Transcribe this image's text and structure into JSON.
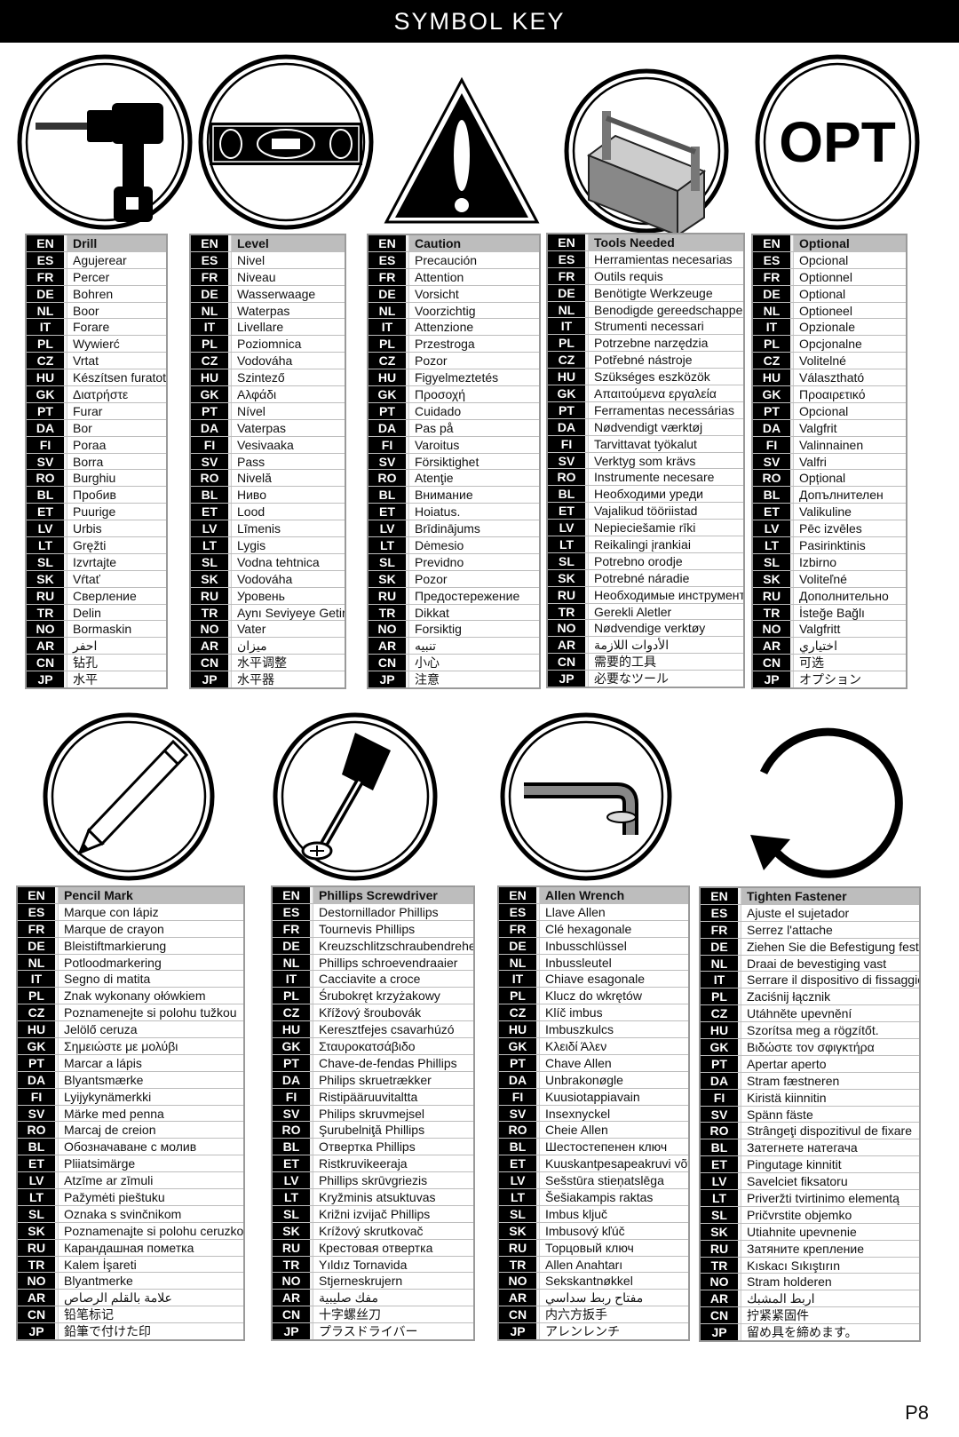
{
  "header": {
    "title": "SYMBOL KEY"
  },
  "page_number": "P8",
  "symbols": [
    {
      "icon": "drill-icon",
      "rows": [
        [
          "EN",
          "Drill"
        ],
        [
          "ES",
          "Agujerear"
        ],
        [
          "FR",
          "Percer"
        ],
        [
          "DE",
          "Bohren"
        ],
        [
          "NL",
          "Boor"
        ],
        [
          "IT",
          "Forare"
        ],
        [
          "PL",
          "Wywierć"
        ],
        [
          "CZ",
          "Vrtat"
        ],
        [
          "HU",
          "Készítsen furatot"
        ],
        [
          "GK",
          "Διατρήστε"
        ],
        [
          "PT",
          "Furar"
        ],
        [
          "DA",
          "Bor"
        ],
        [
          "FI",
          "Poraa"
        ],
        [
          "SV",
          "Borra"
        ],
        [
          "RO",
          "Burghiu"
        ],
        [
          "BL",
          "Пробив"
        ],
        [
          "ET",
          "Puurige"
        ],
        [
          "LV",
          "Urbis"
        ],
        [
          "LT",
          "Gręžti"
        ],
        [
          "SL",
          "Izvrtajte"
        ],
        [
          "SK",
          "Vŕtať"
        ],
        [
          "RU",
          "Сверление"
        ],
        [
          "TR",
          "Delin"
        ],
        [
          "NO",
          "Bormaskin"
        ],
        [
          "AR",
          "احفر"
        ],
        [
          "CN",
          "钻孔"
        ],
        [
          "JP",
          "水平"
        ]
      ]
    },
    {
      "icon": "level-icon",
      "rows": [
        [
          "EN",
          "Level"
        ],
        [
          "ES",
          "Nivel"
        ],
        [
          "FR",
          "Niveau"
        ],
        [
          "DE",
          "Wasserwaage"
        ],
        [
          "NL",
          "Waterpas"
        ],
        [
          "IT",
          "Livellare"
        ],
        [
          "PL",
          "Poziomnica"
        ],
        [
          "CZ",
          "Vodováha"
        ],
        [
          "HU",
          "Szintező"
        ],
        [
          "GK",
          "Αλφάδι"
        ],
        [
          "PT",
          "Nível"
        ],
        [
          "DA",
          "Vaterpas"
        ],
        [
          "FI",
          "Vesivaaka"
        ],
        [
          "SV",
          "Pass"
        ],
        [
          "RO",
          "Nivelă"
        ],
        [
          "BL",
          "Ниво"
        ],
        [
          "ET",
          "Lood"
        ],
        [
          "LV",
          "Līmenis"
        ],
        [
          "LT",
          "Lygis"
        ],
        [
          "SL",
          "Vodna tehtnica"
        ],
        [
          "SK",
          "Vodováha"
        ],
        [
          "RU",
          "Уровень"
        ],
        [
          "TR",
          "Aynı Seviyeye Getir"
        ],
        [
          "NO",
          "Vater"
        ],
        [
          "AR",
          "ميزان"
        ],
        [
          "CN",
          "水平调整"
        ],
        [
          "JP",
          "水平器"
        ]
      ]
    },
    {
      "icon": "caution-icon",
      "rows": [
        [
          "EN",
          "Caution"
        ],
        [
          "ES",
          "Precaución"
        ],
        [
          "FR",
          "Attention"
        ],
        [
          "DE",
          "Vorsicht"
        ],
        [
          "NL",
          "Voorzichtig"
        ],
        [
          "IT",
          "Attenzione"
        ],
        [
          "PL",
          "Przestroga"
        ],
        [
          "CZ",
          "Pozor"
        ],
        [
          "HU",
          "Figyelmeztetés"
        ],
        [
          "GK",
          "Προσοχή"
        ],
        [
          "PT",
          "Cuidado"
        ],
        [
          "DA",
          "Pas på"
        ],
        [
          "FI",
          "Varoitus"
        ],
        [
          "SV",
          "Försiktighet"
        ],
        [
          "RO",
          "Atenţie"
        ],
        [
          "BL",
          "Внимание"
        ],
        [
          "ET",
          "Hoiatus."
        ],
        [
          "LV",
          "Brīdinājums"
        ],
        [
          "LT",
          "Dėmesio"
        ],
        [
          "SL",
          "Previdno"
        ],
        [
          "SK",
          "Pozor"
        ],
        [
          "RU",
          "Предостережение"
        ],
        [
          "TR",
          "Dikkat"
        ],
        [
          "NO",
          "Forsiktig"
        ],
        [
          "AR",
          "تنبيه"
        ],
        [
          "CN",
          "小心"
        ],
        [
          "JP",
          "注意"
        ]
      ]
    },
    {
      "icon": "toolbox-icon",
      "rows": [
        [
          "EN",
          "Tools Needed"
        ],
        [
          "ES",
          "Herramientas necesarias"
        ],
        [
          "FR",
          "Outils requis"
        ],
        [
          "DE",
          "Benötigte Werkzeuge"
        ],
        [
          "NL",
          "Benodigde gereedschappen"
        ],
        [
          "IT",
          "Strumenti necessari"
        ],
        [
          "PL",
          "Potrzebne narzędzia"
        ],
        [
          "CZ",
          "Potřebné nástroje"
        ],
        [
          "HU",
          "Szükséges eszközök"
        ],
        [
          "GK",
          "Απαιτούμενα εργαλεία"
        ],
        [
          "PT",
          "Ferramentas necessárias"
        ],
        [
          "DA",
          "Nødvendigt værktøj"
        ],
        [
          "FI",
          "Tarvittavat työkalut"
        ],
        [
          "SV",
          "Verktyg som krävs"
        ],
        [
          "RO",
          "Instrumente necesare"
        ],
        [
          "BL",
          "Необходими уреди"
        ],
        [
          "ET",
          "Vajalikud tööriistad"
        ],
        [
          "LV",
          "Nepieciešamie rīki"
        ],
        [
          "LT",
          "Reikalingi įrankiai"
        ],
        [
          "SL",
          "Potrebno orodje"
        ],
        [
          "SK",
          "Potrebné náradie"
        ],
        [
          "RU",
          "Необходимые инструменты"
        ],
        [
          "TR",
          "Gerekli Aletler"
        ],
        [
          "NO",
          "Nødvendige verktøy"
        ],
        [
          "AR",
          "الأدوات اللازمة"
        ],
        [
          "CN",
          "需要的工具"
        ],
        [
          "JP",
          "必要なツール"
        ]
      ]
    },
    {
      "icon": "optional-icon",
      "icon_text": "OPT",
      "rows": [
        [
          "EN",
          "Optional"
        ],
        [
          "ES",
          "Opcional"
        ],
        [
          "FR",
          "Optionnel"
        ],
        [
          "DE",
          "Optional"
        ],
        [
          "NL",
          "Optioneel"
        ],
        [
          "IT",
          "Opzionale"
        ],
        [
          "PL",
          "Opcjonalne"
        ],
        [
          "CZ",
          "Volitelné"
        ],
        [
          "HU",
          "Választható"
        ],
        [
          "GK",
          "Προαιρετικό"
        ],
        [
          "PT",
          "Opcional"
        ],
        [
          "DA",
          "Valgfrit"
        ],
        [
          "FI",
          "Valinnainen"
        ],
        [
          "SV",
          "Valfri"
        ],
        [
          "RO",
          "Opțional"
        ],
        [
          "BL",
          "Допълнителен"
        ],
        [
          "ET",
          "Valikuline"
        ],
        [
          "LV",
          "Pēc izvēles"
        ],
        [
          "LT",
          "Pasirinktinis"
        ],
        [
          "SL",
          "Izbirno"
        ],
        [
          "SK",
          "Voliteľné"
        ],
        [
          "RU",
          "Дополнительно"
        ],
        [
          "TR",
          "İsteğe Bağlı"
        ],
        [
          "NO",
          "Valgfritt"
        ],
        [
          "AR",
          "اختياري"
        ],
        [
          "CN",
          "可选"
        ],
        [
          "JP",
          "オプション"
        ]
      ]
    },
    {
      "icon": "pencil-icon",
      "rows": [
        [
          "EN",
          "Pencil Mark"
        ],
        [
          "ES",
          "Marque con lápiz"
        ],
        [
          "FR",
          "Marque de crayon"
        ],
        [
          "DE",
          "Bleistiftmarkierung"
        ],
        [
          "NL",
          "Potloodmarkering"
        ],
        [
          "IT",
          "Segno di matita"
        ],
        [
          "PL",
          "Znak wykonany ołówkiem"
        ],
        [
          "CZ",
          "Poznamenejte si polohu tužkou"
        ],
        [
          "HU",
          "Jelölő ceruza"
        ],
        [
          "GK",
          "Σημειώστε με μολύβι"
        ],
        [
          "PT",
          "Marcar a lápis"
        ],
        [
          "DA",
          "Blyantsmærke"
        ],
        [
          "FI",
          "Lyijykynämerkki"
        ],
        [
          "SV",
          "Märke med penna"
        ],
        [
          "RO",
          "Marcaj de creion"
        ],
        [
          "BL",
          "Обозначаване с молив"
        ],
        [
          "ET",
          "Pliiatsimärge"
        ],
        [
          "LV",
          "Atzīme ar zīmuli"
        ],
        [
          "LT",
          "Pažymėti pieštuku"
        ],
        [
          "SL",
          "Oznaka s svinčnikom"
        ],
        [
          "SK",
          "Poznamenajte si polohu ceruzkou"
        ],
        [
          "RU",
          "Карандашная пометка"
        ],
        [
          "TR",
          "Kalem İşareti"
        ],
        [
          "NO",
          "Blyantmerke"
        ],
        [
          "AR",
          "علامة بالقلم الرصاص"
        ],
        [
          "CN",
          "铅笔标记"
        ],
        [
          "JP",
          "鉛筆で付けた印"
        ]
      ]
    },
    {
      "icon": "phillips-screwdriver-icon",
      "rows": [
        [
          "EN",
          "Phillips Screwdriver"
        ],
        [
          "ES",
          "Destornillador Phillips"
        ],
        [
          "FR",
          "Tournevis Phillips"
        ],
        [
          "DE",
          "Kreuzschlitzschraubendreher"
        ],
        [
          "NL",
          "Phillips schroevendraaier"
        ],
        [
          "IT",
          "Cacciavite a croce"
        ],
        [
          "PL",
          "Śrubokręt krzyżakowy"
        ],
        [
          "CZ",
          "Křížový šroubovák"
        ],
        [
          "HU",
          "Keresztfejes csavarhúzó"
        ],
        [
          "GK",
          "Σταυροκατσάβιδο"
        ],
        [
          "PT",
          "Chave-de-fendas Phillips"
        ],
        [
          "DA",
          "Philips skruetrækker"
        ],
        [
          "FI",
          "Ristipääruuvitaltta"
        ],
        [
          "SV",
          "Philips skruvmejsel"
        ],
        [
          "RO",
          "Şurubelniţă Phillips"
        ],
        [
          "BL",
          "Отвертка Phillips"
        ],
        [
          "ET",
          "Ristkruvikeeraja"
        ],
        [
          "LV",
          "Phillips skrūvgriezis"
        ],
        [
          "LT",
          "Kryžminis atsuktuvas"
        ],
        [
          "SL",
          "Križni izvijač Phillips"
        ],
        [
          "SK",
          "Krížový skrutkovač"
        ],
        [
          "RU",
          "Крестовая отвертка"
        ],
        [
          "TR",
          "Yıldız Tornavida"
        ],
        [
          "NO",
          "Stjerneskrujern"
        ],
        [
          "AR",
          "مفك صليبية"
        ],
        [
          "CN",
          "十字螺丝刀"
        ],
        [
          "JP",
          "プラスドライバー"
        ]
      ]
    },
    {
      "icon": "allen-wrench-icon",
      "rows": [
        [
          "EN",
          "Allen Wrench"
        ],
        [
          "ES",
          "Llave Allen"
        ],
        [
          "FR",
          "Clé hexagonale"
        ],
        [
          "DE",
          "Inbusschlüssel"
        ],
        [
          "NL",
          "Inbussleutel"
        ],
        [
          "IT",
          "Chiave esagonale"
        ],
        [
          "PL",
          "Klucz do wkrętów"
        ],
        [
          "CZ",
          "Klíč imbus"
        ],
        [
          "HU",
          "Imbuszkulcs"
        ],
        [
          "GK",
          "Κλειδί Άλεν"
        ],
        [
          "PT",
          "Chave Allen"
        ],
        [
          "DA",
          "Unbrakonøgle"
        ],
        [
          "FI",
          "Kuusiotappiavain"
        ],
        [
          "SV",
          "Insexnyckel"
        ],
        [
          "RO",
          "Cheie Allen"
        ],
        [
          "BL",
          "Шестостепенен ключ"
        ],
        [
          "ET",
          "Kuuskantpesapeakruvi võti"
        ],
        [
          "LV",
          "Sešstūra stieņatslēga"
        ],
        [
          "LT",
          "Šešiakampis raktas"
        ],
        [
          "SL",
          "Imbus ključ"
        ],
        [
          "SK",
          "Imbusový kľúč"
        ],
        [
          "RU",
          "Торцовый ключ"
        ],
        [
          "TR",
          "Allen Anahtarı"
        ],
        [
          "NO",
          "Sekskantnøkkel"
        ],
        [
          "AR",
          "مفتاح ربط سداسي"
        ],
        [
          "CN",
          "内六方扳手"
        ],
        [
          "JP",
          "アレンレンチ"
        ]
      ]
    },
    {
      "icon": "tighten-arrow-icon",
      "rows": [
        [
          "EN",
          "Tighten Fastener"
        ],
        [
          "ES",
          "Ajuste el sujetador"
        ],
        [
          "FR",
          "Serrez l'attache"
        ],
        [
          "DE",
          "Ziehen Sie die Befestigung fest"
        ],
        [
          "NL",
          "Draai de bevestiging vast"
        ],
        [
          "IT",
          "Serrare il dispositivo di fissaggio"
        ],
        [
          "PL",
          "Zaciśnij łącznik"
        ],
        [
          "CZ",
          "Utáhněte upevnění"
        ],
        [
          "HU",
          "Szorítsa meg a rögzítőt."
        ],
        [
          "GK",
          "Βιδώστε τον σφιγκτήρα"
        ],
        [
          "PT",
          "Apertar aperto"
        ],
        [
          "DA",
          "Stram fæstneren"
        ],
        [
          "FI",
          "Kiristä kiinnitin"
        ],
        [
          "SV",
          "Spänn fäste"
        ],
        [
          "RO",
          "Strângeţi dispozitivul de fixare"
        ],
        [
          "BL",
          "Затегнете натегача"
        ],
        [
          "ET",
          "Pingutage kinnitit"
        ],
        [
          "LV",
          "Savelciet fiksatoru"
        ],
        [
          "LT",
          "Priveržti tvirtinimo elementą"
        ],
        [
          "SL",
          "Pričvrstite objemko"
        ],
        [
          "SK",
          "Utiahnite upevnenie"
        ],
        [
          "RU",
          "Затяните крепление"
        ],
        [
          "TR",
          "Kıskacı Sıkıştırın"
        ],
        [
          "NO",
          "Stram holderen"
        ],
        [
          "AR",
          "اربط المشبك"
        ],
        [
          "CN",
          "拧紧紧固件"
        ],
        [
          "JP",
          "留め具を締めます。"
        ]
      ]
    }
  ]
}
